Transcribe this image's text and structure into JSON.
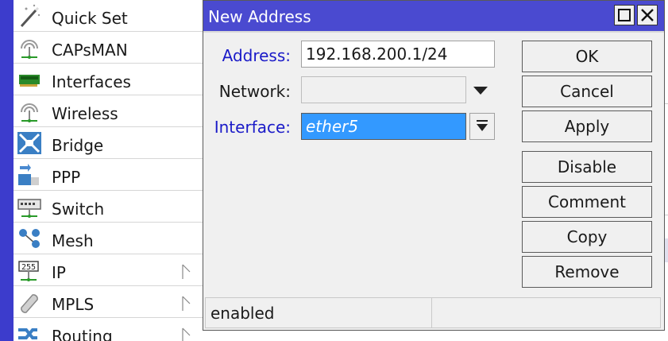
{
  "menu": {
    "items": [
      {
        "label": "Quick Set",
        "icon": "magic-wand-icon",
        "submenu": false
      },
      {
        "label": "CAPsMAN",
        "icon": "wireless-tower-icon",
        "submenu": false
      },
      {
        "label": "Interfaces",
        "icon": "network-card-icon",
        "submenu": false
      },
      {
        "label": "Wireless",
        "icon": "wireless-tower-icon",
        "submenu": false
      },
      {
        "label": "Bridge",
        "icon": "bridge-icon",
        "submenu": false
      },
      {
        "label": "PPP",
        "icon": "ppp-icon",
        "submenu": false
      },
      {
        "label": "Switch",
        "icon": "switch-icon",
        "submenu": false
      },
      {
        "label": "Mesh",
        "icon": "mesh-icon",
        "submenu": false
      },
      {
        "label": "IP",
        "icon": "ip-icon",
        "submenu": true
      },
      {
        "label": "MPLS",
        "icon": "mpls-icon",
        "submenu": true
      },
      {
        "label": "Routing",
        "icon": "routing-icon",
        "submenu": true
      }
    ]
  },
  "dialog": {
    "title": "New Address",
    "fields": {
      "address_label": "Address:",
      "address_value": "192.168.200.1/24",
      "network_label": "Network:",
      "network_value": "",
      "interface_label": "Interface:",
      "interface_value": "ether5"
    },
    "buttons": {
      "ok": "OK",
      "cancel": "Cancel",
      "apply": "Apply",
      "disable": "Disable",
      "comment": "Comment",
      "copy": "Copy",
      "remove": "Remove"
    },
    "status": "enabled"
  },
  "colors": {
    "titlebar": "#4a4ad0",
    "side_strip": "#3c3ccc",
    "label_blue": "#1a1ac8",
    "selection": "#3399ff"
  }
}
